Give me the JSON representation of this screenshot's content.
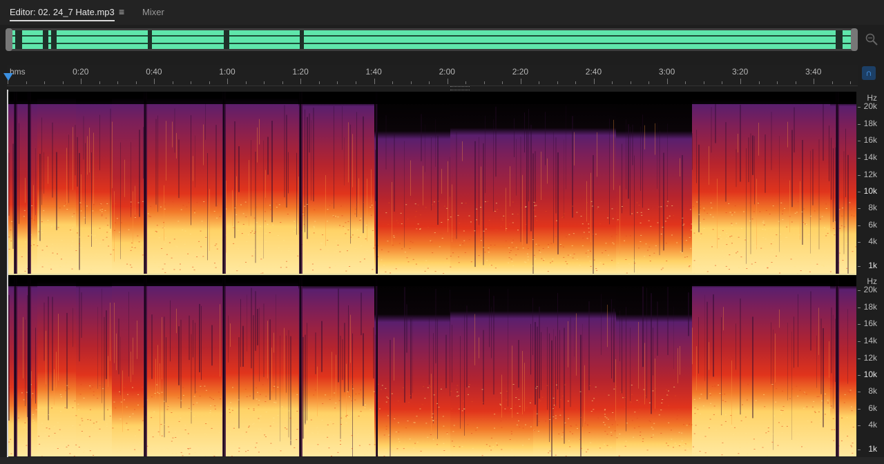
{
  "tabs": {
    "editor_label": "Editor: 02. 24_7 Hate.mp3",
    "menu_glyph": "≡",
    "mixer_label": "Mixer"
  },
  "overview": {
    "waveform_color": "#5fe6ab"
  },
  "timeline": {
    "unit_label": "hms",
    "labels": [
      "0:20",
      "0:40",
      "1:00",
      "1:20",
      "1:40",
      "2:00",
      "2:20",
      "2:40",
      "3:00",
      "3:20",
      "3:40"
    ],
    "snap_icon": "magnet-icon"
  },
  "channels": [
    {
      "hz_title": "Hz",
      "hz_labels": [
        "20k",
        "18k",
        "16k",
        "14k",
        "12k",
        "10k",
        "8k",
        "6k",
        "4k",
        "1k"
      ]
    },
    {
      "hz_title": "Hz",
      "hz_labels": [
        "20k",
        "18k",
        "16k",
        "14k",
        "12k",
        "10k",
        "8k",
        "6k",
        "4k",
        "1k"
      ]
    }
  ],
  "colors": {
    "background": "#1e1e1e",
    "playhead": "#3b8fe0",
    "spectral_low": "#ffd266",
    "spectral_mid": "#e0341c",
    "spectral_high": "#5a1f6e"
  }
}
